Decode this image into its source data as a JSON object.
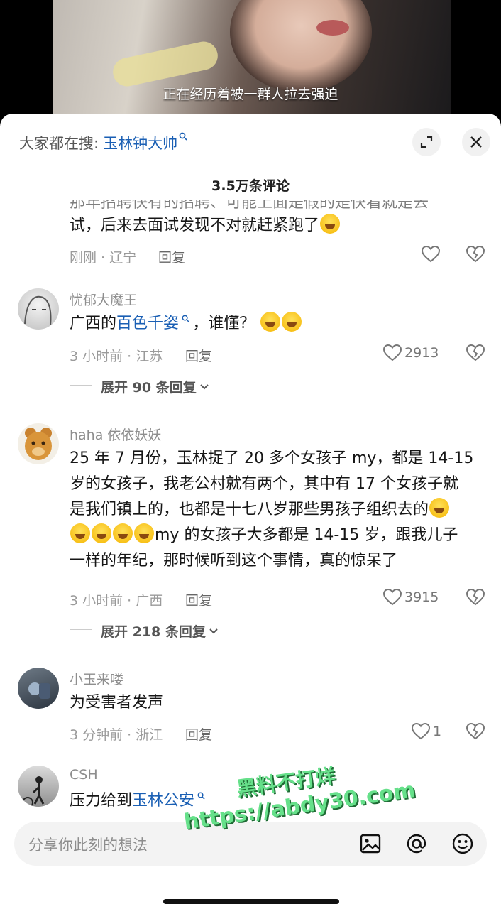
{
  "video": {
    "caption": "正在经历着被一群人拉去强迫"
  },
  "header": {
    "search_prefix": "大家都在搜:",
    "search_term": "玉林钟大帅",
    "search_icon": "search-icon",
    "expand_icon": "expand-icon",
    "close_icon": "close-icon"
  },
  "comment_count": "3.5万条评论",
  "comments": [
    {
      "text_partial_top": "那年招聘快有的招聘、可能上面是假的是快看就是去",
      "text": "试，后来去面试发现不对就赶紧跑了",
      "meta": "刚刚 · 辽宁",
      "reply": "回复",
      "likes": ""
    },
    {
      "author": "忧郁大魔王",
      "text_before": "广西的",
      "text_link": "百色千姿",
      "text_after": "，谁懂？",
      "meta": "3 小时前 · 江苏",
      "reply": "回复",
      "likes": "2913",
      "expand": "展开 90 条回复"
    },
    {
      "author": "haha 依依妖妖",
      "text_line1": "25 年 7 月份，玉林捉了 20 多个女孩子 my，都是 14-15",
      "text_line2": "岁的女孩子，我老公村就有两个，其中有 17 个女孩子就",
      "text_line3": "是我们镇上的，也都是十七八岁那些男孩子组织去的",
      "text_line4": "my 的女孩子大多都是 14-15 岁，跟我儿子",
      "text_line5": "一样的年纪，那时候听到这个事情，真的惊呆了",
      "meta": "3 小时前 · 广西",
      "reply": "回复",
      "likes": "3915",
      "expand": "展开 218 条回复"
    },
    {
      "author": "小玉来喽",
      "text": "为受害者发声",
      "meta": "3 分钟前 · 浙江",
      "reply": "回复",
      "likes": "1"
    },
    {
      "author": "CSH",
      "text_before": "压力给到",
      "text_link": "玉林公安"
    }
  ],
  "input": {
    "placeholder": "分享你此刻的想法",
    "image_icon": "image-icon",
    "mention_icon": "at-icon",
    "emoji_icon": "emoji-icon"
  },
  "watermark": {
    "line1": "黑料不打烊",
    "line2": "https://abdy30.com"
  }
}
